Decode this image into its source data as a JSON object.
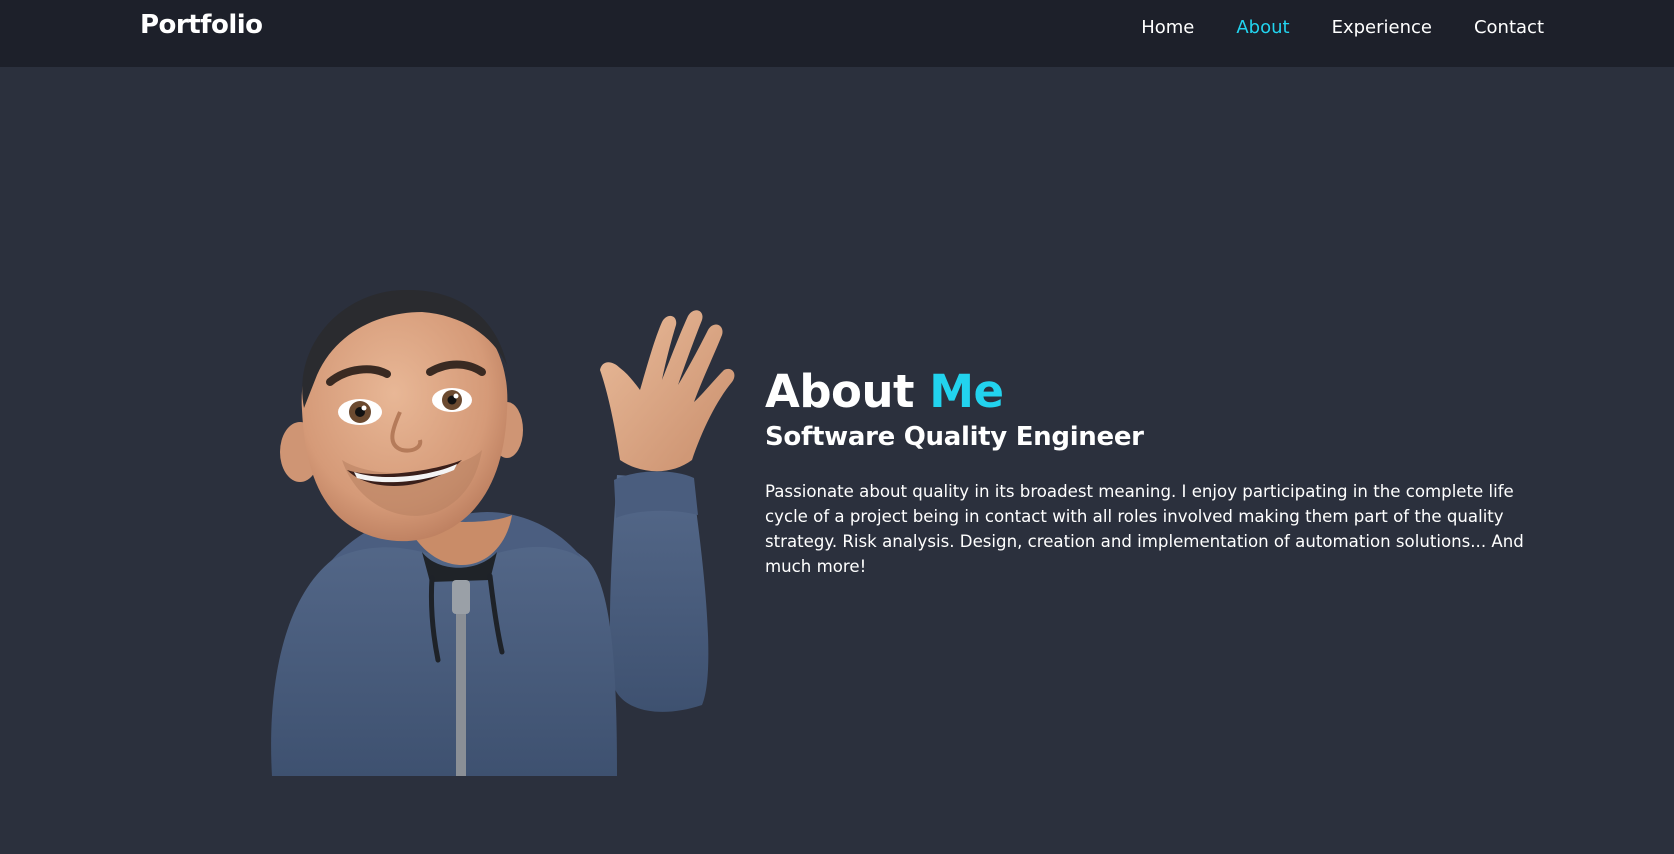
{
  "nav": {
    "brand": "Portfolio",
    "links": [
      {
        "label": "Home"
      },
      {
        "label": "About",
        "active": true
      },
      {
        "label": "Experience"
      },
      {
        "label": "Contact"
      }
    ]
  },
  "about": {
    "title_main": "About",
    "title_accent": "Me",
    "subtitle": "Software Quality Engineer",
    "description": "Passionate about quality in its broadest meaning. I enjoy participating in the complete life cycle of a project being in contact with all roles involved making them part of the quality strategy. Risk analysis. Design, creation and implementation of automation solutions... And much more!"
  },
  "avatar": {
    "icon": "waving-memoji-avatar"
  },
  "colors": {
    "page_bg": "#2b303d",
    "nav_bg": "#1d202a",
    "accent": "#22d3ee",
    "text": "#ffffff"
  }
}
